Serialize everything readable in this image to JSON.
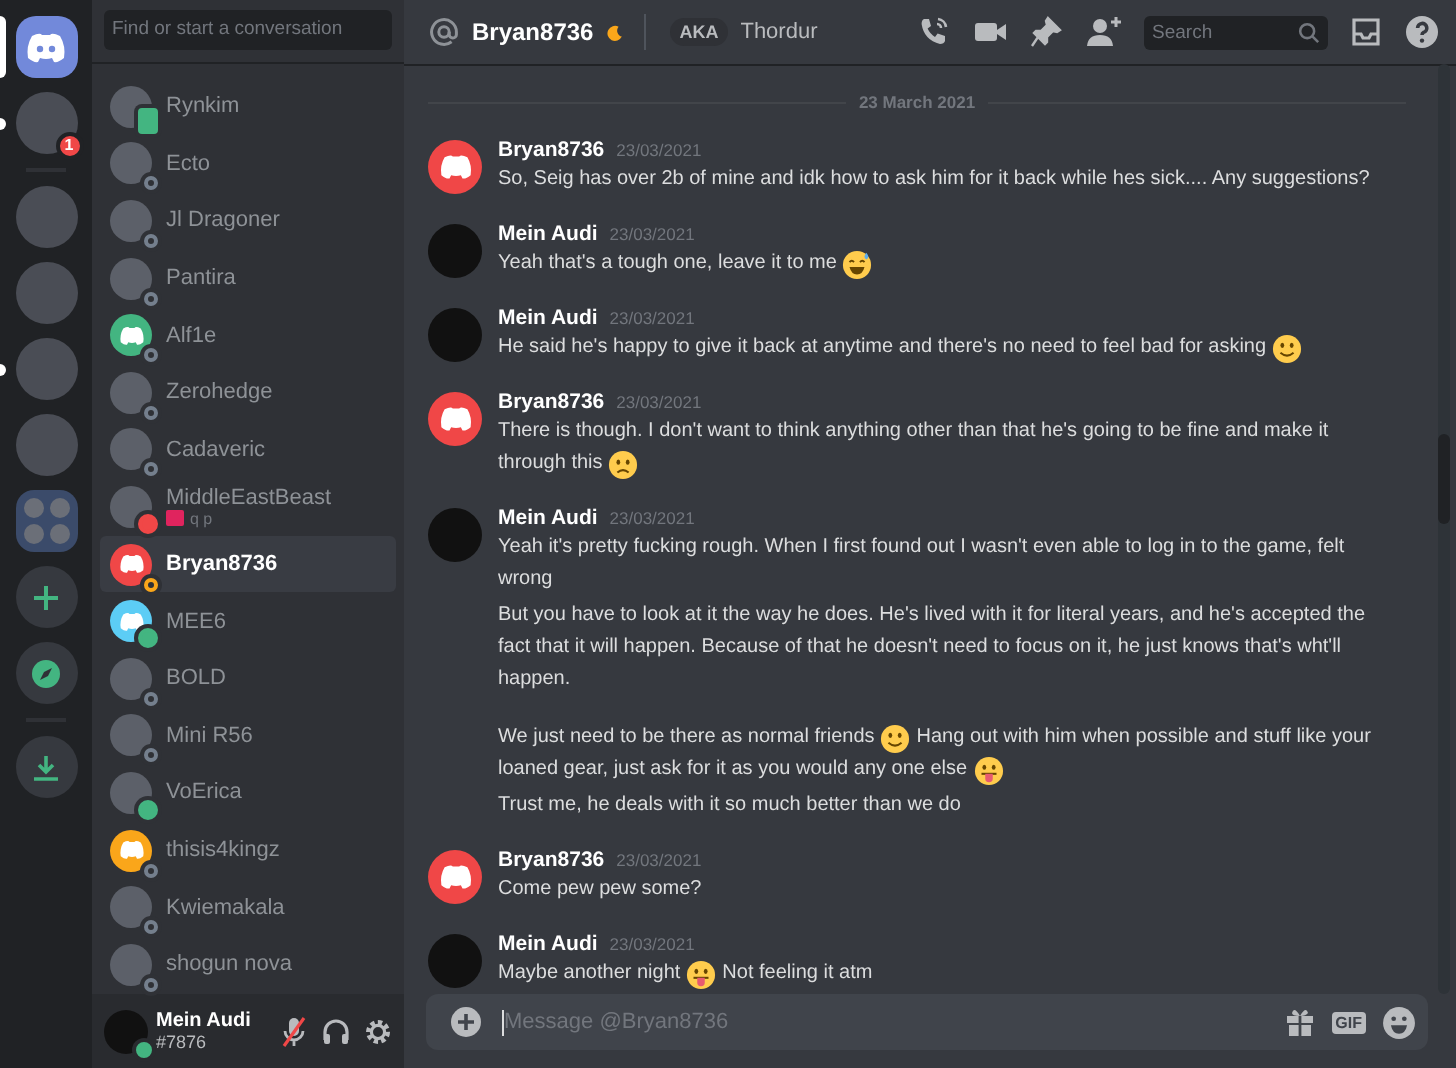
{
  "rail": [
    {
      "kind": "home",
      "selected": true
    },
    {
      "kind": "avatar",
      "badge": "1",
      "unread": true
    },
    {
      "kind": "divider"
    },
    {
      "kind": "server"
    },
    {
      "kind": "server"
    },
    {
      "kind": "server",
      "unread": true
    },
    {
      "kind": "server"
    },
    {
      "kind": "folder"
    },
    {
      "kind": "add"
    },
    {
      "kind": "explore"
    },
    {
      "kind": "divider"
    },
    {
      "kind": "download"
    }
  ],
  "dm_search": {
    "placeholder": "Find or start a conversation"
  },
  "dms": [
    {
      "name": "Rynkim",
      "avatar": {
        "kind": "photo"
      },
      "status": {
        "kind": "phone",
        "color": "#43b581"
      },
      "selected": false
    },
    {
      "name": "Ecto",
      "avatar": {
        "kind": "photo"
      },
      "status": {
        "kind": "ring",
        "color": "#747f8d"
      },
      "selected": false
    },
    {
      "name": "Jl Dragoner",
      "avatar": {
        "kind": "photo"
      },
      "status": {
        "kind": "ring",
        "color": "#747f8d"
      },
      "selected": false
    },
    {
      "name": "Pantira",
      "avatar": {
        "kind": "photo"
      },
      "status": {
        "kind": "ring",
        "color": "#747f8d"
      },
      "selected": false
    },
    {
      "name": "Alf1e",
      "avatar": {
        "kind": "logo",
        "color": "#43b581"
      },
      "status": {
        "kind": "ring",
        "color": "#747f8d"
      },
      "selected": false
    },
    {
      "name": "Zerohedge",
      "avatar": {
        "kind": "photo"
      },
      "status": {
        "kind": "ring",
        "color": "#747f8d"
      },
      "selected": false
    },
    {
      "name": "Cadaveric",
      "avatar": {
        "kind": "photo"
      },
      "status": {
        "kind": "ring",
        "color": "#747f8d"
      },
      "selected": false
    },
    {
      "name": "MiddleEastBeast",
      "avatar": {
        "kind": "photo"
      },
      "status": {
        "kind": "minus",
        "color": "#f04747"
      },
      "selected": false,
      "activity": "q p"
    },
    {
      "name": "Bryan8736",
      "avatar": {
        "kind": "logo",
        "color": "#f04747"
      },
      "status": {
        "kind": "moon",
        "color": "#faa61a"
      },
      "selected": true
    },
    {
      "name": "MEE6",
      "avatar": {
        "kind": "logo",
        "color": "#5ccdf5"
      },
      "status": {
        "kind": "dot",
        "color": "#43b581"
      },
      "selected": false
    },
    {
      "name": "BOLD",
      "avatar": {
        "kind": "photo"
      },
      "status": {
        "kind": "ring",
        "color": "#747f8d"
      },
      "selected": false
    },
    {
      "name": "Mini R56",
      "avatar": {
        "kind": "photo"
      },
      "status": {
        "kind": "ring",
        "color": "#747f8d"
      },
      "selected": false
    },
    {
      "name": "VoErica",
      "avatar": {
        "kind": "photo"
      },
      "status": {
        "kind": "dot",
        "color": "#43b581"
      },
      "selected": false
    },
    {
      "name": "thisis4kingz",
      "avatar": {
        "kind": "logo",
        "color": "#faa61a"
      },
      "status": {
        "kind": "ring",
        "color": "#747f8d"
      },
      "selected": false
    },
    {
      "name": "Kwiemakala",
      "avatar": {
        "kind": "photo"
      },
      "status": {
        "kind": "ring",
        "color": "#747f8d"
      },
      "selected": false
    },
    {
      "name": "shogun nova",
      "avatar": {
        "kind": "photo"
      },
      "status": {
        "kind": "ring",
        "color": "#747f8d"
      },
      "selected": false
    }
  ],
  "user_panel": {
    "name": "Mein Audi",
    "tag": "#7876",
    "status": {
      "kind": "dot",
      "color": "#43b581"
    },
    "muted": true
  },
  "header": {
    "name": "Bryan8736",
    "status": {
      "kind": "moon",
      "color": "#faa61a"
    },
    "aka_label": "AKA",
    "aka_name": "Thordur",
    "search_placeholder": "Search"
  },
  "date_divider": "23 March 2021",
  "messages": [
    {
      "author": "Bryan8736",
      "avatar": {
        "kind": "logo",
        "color": "#f04747"
      },
      "time": "23/03/2021",
      "paragraphs": [
        [
          [
            {
              "kind": "text",
              "text": "So, Seig has over 2b of mine and idk how to ask him for it back while hes sick.... Any suggestions?"
            }
          ]
        ]
      ]
    },
    {
      "author": "Mein Audi",
      "avatar": {
        "kind": "photo"
      },
      "time": "23/03/2021",
      "paragraphs": [
        [
          [
            {
              "kind": "text",
              "text": "Yeah that's a tough one, leave it to me"
            },
            {
              "kind": "sweat"
            }
          ]
        ]
      ]
    },
    {
      "author": "Mein Audi",
      "avatar": {
        "kind": "photo"
      },
      "time": "23/03/2021",
      "paragraphs": [
        [
          [
            {
              "kind": "text",
              "text": "He said he's happy to give it back at anytime and there's no need to feel bad for asking"
            },
            {
              "kind": "smile"
            }
          ]
        ]
      ]
    },
    {
      "author": "Bryan8736",
      "avatar": {
        "kind": "logo",
        "color": "#f04747"
      },
      "time": "23/03/2021",
      "paragraphs": [
        [
          [
            {
              "kind": "text",
              "text": "There is though. I don't want to think anything other than that he's going to be fine and make it"
            }
          ],
          [
            {
              "kind": "text",
              "text": "through this"
            },
            {
              "kind": "frown"
            }
          ]
        ]
      ]
    },
    {
      "author": "Mein Audi",
      "avatar": {
        "kind": "photo"
      },
      "time": "23/03/2021",
      "paragraphs": [
        [
          [
            {
              "kind": "text",
              "text": "Yeah it's pretty fucking rough. When I first found out I wasn't even able to log in to the game, felt"
            }
          ],
          [
            {
              "kind": "text",
              "text": "wrong"
            }
          ]
        ],
        [
          [
            {
              "kind": "text",
              "text": "But you have to look at it the way he does. He's lived with it for literal years, and he's accepted the"
            }
          ],
          [
            {
              "kind": "text",
              "text": "fact that it will happen. Because of that he doesn't need to focus on it, he just knows that's wht'll"
            }
          ],
          [
            {
              "kind": "text",
              "text": "happen."
            }
          ]
        ],
        [
          [
            {
              "kind": "text",
              "text": "We just need to be there as normal friends"
            },
            {
              "kind": "smile"
            },
            {
              "kind": "text",
              "text": "Hang out with him when possible and stuff like your"
            }
          ],
          [
            {
              "kind": "text",
              "text": "loaned gear, just ask for it as you would any one else"
            },
            {
              "kind": "tongue"
            }
          ]
        ],
        [
          [
            {
              "kind": "text",
              "text": "Trust me, he deals with it so much better than we do"
            }
          ]
        ]
      ]
    },
    {
      "author": "Bryan8736",
      "avatar": {
        "kind": "logo",
        "color": "#f04747"
      },
      "time": "23/03/2021",
      "paragraphs": [
        [
          [
            {
              "kind": "text",
              "text": "Come pew pew some?"
            }
          ]
        ]
      ]
    },
    {
      "author": "Mein Audi",
      "avatar": {
        "kind": "photo"
      },
      "time": "23/03/2021",
      "paragraphs": [
        [
          [
            {
              "kind": "text",
              "text": "Maybe another night"
            },
            {
              "kind": "tongue"
            },
            {
              "kind": "text",
              "text": "Not feeling it atm"
            }
          ]
        ]
      ]
    }
  ],
  "composer": {
    "placeholder": "Message @Bryan8736",
    "gif_label": "GIF"
  }
}
